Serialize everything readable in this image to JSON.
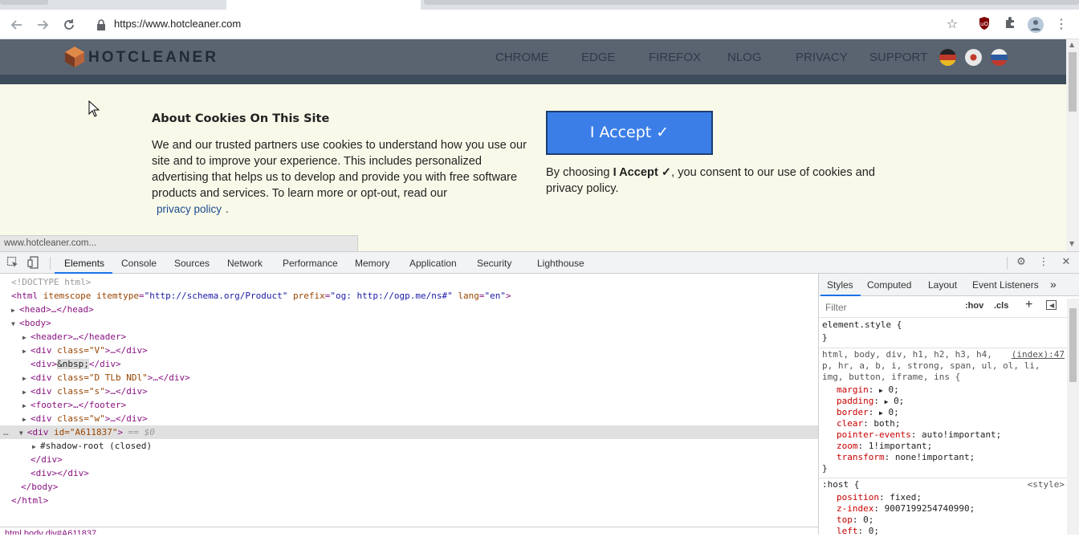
{
  "browser": {
    "url": "https://www.hotcleaner.com",
    "status_url": "www.hotcleaner.com..."
  },
  "site": {
    "logo_text": "HOTCLEANER",
    "menu": [
      "CHROME",
      "EDGE",
      "FIREFOX",
      "NLOG",
      "PRIVACY",
      "SUPPORT"
    ],
    "cookie_title": "About Cookies On This Site",
    "cookie_text": "We and our trusted partners use cookies to understand how you use our site and to improve your experience. This includes personalized advertising that helps us to develop and provide you with free software products and services. To learn more or opt-out, read our",
    "privacy_link": "privacy policy",
    "period": ".",
    "accept_label": "I Accept ✓",
    "consent_prefix": "By choosing",
    "consent_bold": "I Accept ✓",
    "consent_suffix": ", you consent to our use of cookies and privacy policy.",
    "colors": {
      "accept_bg": "#3b7ee8",
      "banner_bg": "#f9f9ea",
      "header_bg": "#5a6470"
    }
  },
  "devtools": {
    "tabs": [
      "Elements",
      "Console",
      "Sources",
      "Network",
      "Performance",
      "Memory",
      "Application",
      "Security",
      "Lighthouse"
    ],
    "active_tab": "Elements",
    "dom": {
      "doctype": "<!DOCTYPE html>",
      "html_open_tag": "html",
      "html_attrs": [
        {
          "name": "itemscope",
          "value": ""
        },
        {
          "name": "itemtype",
          "value": "\"http://schema.org/Product\""
        },
        {
          "name": "prefix",
          "value": "\"og: http://ogp.me/ns#\""
        },
        {
          "name": "lang",
          "value": "\"en\""
        }
      ],
      "head": "<head>…</head>",
      "body_open": "<body>",
      "header": "<header>…</header>",
      "div_v": "class=\"V\"",
      "nbsp": "&nbsp;",
      "div_d": "class=\"D TLb NDl\"",
      "div_s": "class=\"s\"",
      "footer": "<footer>…</footer>",
      "div_w": "class=\"w\"",
      "div_id": "id=\"A611837\"",
      "selected_marker": "== $0",
      "shadow_root": "#shadow-root (closed)",
      "close_div": "</div>",
      "empty_div": "<div></div>",
      "close_body": "</body>",
      "close_html": "</html>"
    },
    "breadcrumb": "html  body  div#A611837",
    "styles_tabs": [
      "Styles",
      "Computed",
      "Layout",
      "Event Listeners"
    ],
    "filter_placeholder": "Filter",
    "hov": ":hov",
    "cls": ".cls",
    "element_style": "element.style {",
    "close_brace": "}",
    "rule1_selector_1": "html, body, div, h1, h2, h3, h4,",
    "rule1_selector_2": "p, hr, a, b, i, strong, span, ul, ol, li,",
    "rule1_selector_3": "img, button, iframe, ins {",
    "rule1_source": "(index):47",
    "rule1_props": [
      {
        "name": "margin",
        "value": "0;",
        "expand": true
      },
      {
        "name": "padding",
        "value": "0;",
        "expand": true
      },
      {
        "name": "border",
        "value": "0;",
        "expand": true
      },
      {
        "name": "clear",
        "value": "both;",
        "expand": false
      },
      {
        "name": "pointer-events",
        "value": "auto!important;",
        "expand": false
      },
      {
        "name": "zoom",
        "value": "1!important;",
        "expand": false
      },
      {
        "name": "transform",
        "value": "none!important;",
        "expand": false
      }
    ],
    "rule2_selector": ":host {",
    "rule2_source": "<style>",
    "rule2_props": [
      {
        "name": "position",
        "value": "fixed;"
      },
      {
        "name": "z-index",
        "value": "9007199254740990;"
      },
      {
        "name": "top",
        "value": "0;"
      },
      {
        "name": "left",
        "value": "0;"
      }
    ]
  }
}
